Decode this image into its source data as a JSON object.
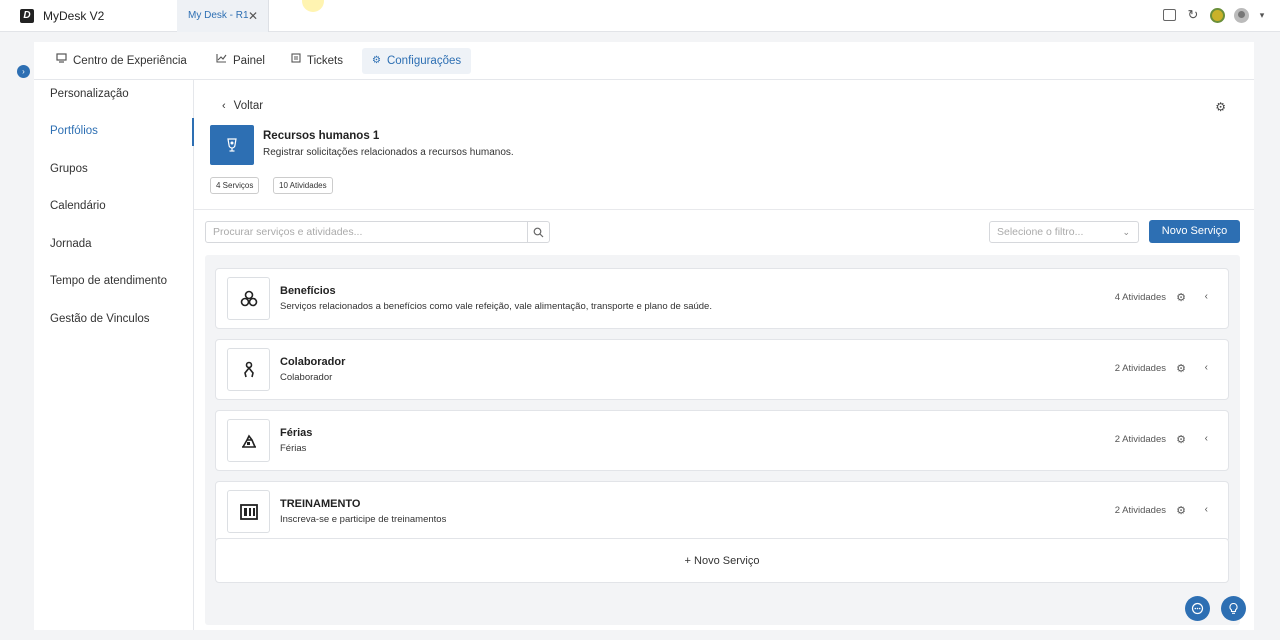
{
  "titlebar": {
    "app_name": "MyDesk V2",
    "logo_letter": "D",
    "tab_label": "My Desk - R1",
    "tab_close": "✕"
  },
  "nav": {
    "items": [
      {
        "label": "Centro de Experiência",
        "icon": "monitor-icon"
      },
      {
        "label": "Painel",
        "icon": "chart-icon"
      },
      {
        "label": "Tickets",
        "icon": "ticket-icon"
      },
      {
        "label": "Configurações",
        "icon": "gear-icon",
        "active": true
      }
    ]
  },
  "sidebar": {
    "items": [
      {
        "label": "Personalização"
      },
      {
        "label": "Portfólios",
        "active": true
      },
      {
        "label": "Grupos"
      },
      {
        "label": "Calendário"
      },
      {
        "label": "Jornada"
      },
      {
        "label": "Tempo de atendimento"
      },
      {
        "label": "Gestão de Vinculos"
      }
    ]
  },
  "portfolio": {
    "back_label": "Voltar",
    "title": "Recursos humanos 1",
    "description": "Registrar solicitações relacionados a recursos humanos.",
    "chips": [
      "4 Serviços",
      "10 Atividades"
    ]
  },
  "toolbar": {
    "search_placeholder": "Procurar serviços e atividades...",
    "filter_placeholder": "Selecione o filtro...",
    "new_button": "Novo Serviço"
  },
  "services": [
    {
      "title": "Benefícios",
      "description": "Serviços relacionados a benefícios como vale refeição, vale alimentação, transporte e plano de saúde.",
      "count": "4 Atividades",
      "icon": "benefits-icon"
    },
    {
      "title": "Colaborador",
      "description": "Colaborador",
      "count": "2 Atividades",
      "icon": "person-icon"
    },
    {
      "title": "Férias",
      "description": "Férias",
      "count": "2 Atividades",
      "icon": "vacation-icon"
    },
    {
      "title": "TREINAMENTO",
      "description": "Inscreva-se e participe de treinamentos",
      "count": "2 Atividades",
      "icon": "training-icon"
    }
  ],
  "add_service_label": "+ Novo Serviço",
  "colors": {
    "accent": "#2d6fb3",
    "background": "#f3f4f6"
  }
}
